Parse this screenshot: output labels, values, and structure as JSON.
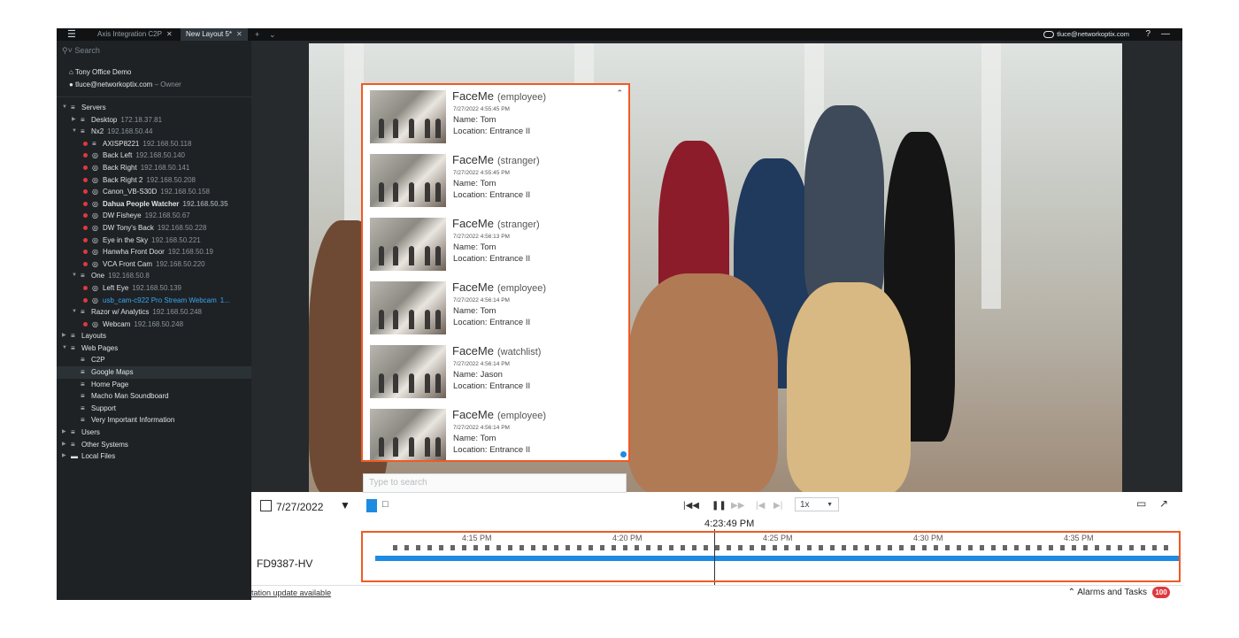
{
  "titlebar": {
    "tabs": [
      {
        "label": "Axis Integration C2P",
        "active": false
      },
      {
        "label": "New Layout 5*",
        "active": true
      }
    ],
    "account": "tluce@networkoptix.com",
    "help": "?",
    "minimize": "—"
  },
  "sidebar": {
    "search_placeholder": "Search",
    "system_name": "Tony Office Demo",
    "user_email": "tluce@networkoptix.com",
    "user_role": "– Owner",
    "tree": [
      {
        "label": "Servers",
        "ip": "",
        "level": 0,
        "icon": "servers-icon",
        "expanded": true
      },
      {
        "label": "Desktop",
        "ip": "172.18.37.81",
        "level": 1,
        "icon": "server-icon",
        "expanded": false
      },
      {
        "label": "Nx2",
        "ip": "192.168.50.44",
        "level": 1,
        "icon": "server-icon",
        "expanded": true
      },
      {
        "label": "AXISP8221",
        "ip": "192.168.50.118",
        "level": 2,
        "icon": "io-module-icon",
        "status": "red"
      },
      {
        "label": "Back Left",
        "ip": "192.168.50.140",
        "level": 2,
        "icon": "camera-icon",
        "status": "red"
      },
      {
        "label": "Back Right",
        "ip": "192.168.50.141",
        "level": 2,
        "icon": "camera-icon",
        "status": "red"
      },
      {
        "label": "Back Right 2",
        "ip": "192.168.50.208",
        "level": 2,
        "icon": "camera-icon",
        "status": "red"
      },
      {
        "label": "Canon_VB-S30D",
        "ip": "192.168.50.158",
        "level": 2,
        "icon": "camera-icon",
        "status": "red"
      },
      {
        "label": "Dahua People Watcher",
        "ip": "192.168.50.35",
        "level": 2,
        "icon": "camera-icon",
        "status": "red",
        "bold": true
      },
      {
        "label": "DW Fisheye",
        "ip": "192.168.50.67",
        "level": 2,
        "icon": "camera-icon",
        "status": "red"
      },
      {
        "label": "DW Tony's Back",
        "ip": "192.168.50.228",
        "level": 2,
        "icon": "camera-icon",
        "status": "red"
      },
      {
        "label": "Eye in the Sky",
        "ip": "192.168.50.221",
        "level": 2,
        "icon": "camera-icon",
        "status": "red"
      },
      {
        "label": "Hanwha Front Door",
        "ip": "192.168.50.19",
        "level": 2,
        "icon": "camera-icon",
        "status": "red"
      },
      {
        "label": "VCA Front Cam",
        "ip": "192.168.50.220",
        "level": 2,
        "icon": "camera-icon",
        "status": "red"
      },
      {
        "label": "One",
        "ip": "192.168.50.8",
        "level": 1,
        "icon": "server-icon",
        "expanded": true
      },
      {
        "label": "Left Eye",
        "ip": "192.168.50.139",
        "level": 2,
        "icon": "camera-icon",
        "status": "red"
      },
      {
        "label": "usb_cam-c922 Pro Stream Webcam",
        "ip": "1...",
        "level": 2,
        "icon": "camera-icon",
        "status": "red",
        "highlight": true
      },
      {
        "label": "Razor w/ Analytics",
        "ip": "192.168.50.248",
        "level": 1,
        "icon": "server-icon",
        "expanded": true
      },
      {
        "label": "Webcam",
        "ip": "192.168.50.248",
        "level": 2,
        "icon": "camera-icon",
        "status": "red"
      },
      {
        "label": "Layouts",
        "ip": "",
        "level": 0,
        "icon": "layouts-icon",
        "expanded": false
      },
      {
        "label": "Web Pages",
        "ip": "",
        "level": 0,
        "icon": "web-pages-icon",
        "expanded": true
      },
      {
        "label": "C2P",
        "ip": "",
        "level": 1,
        "icon": "c2p-icon"
      },
      {
        "label": "Google Maps",
        "ip": "",
        "level": 1,
        "icon": "web-page-icon",
        "selected": true
      },
      {
        "label": "Home Page",
        "ip": "",
        "level": 1,
        "icon": "web-page-icon"
      },
      {
        "label": "Macho Man Soundboard",
        "ip": "",
        "level": 1,
        "icon": "web-page-icon"
      },
      {
        "label": "Support",
        "ip": "",
        "level": 1,
        "icon": "web-page-icon"
      },
      {
        "label": "Very Important Information",
        "ip": "",
        "level": 1,
        "icon": "web-page-icon"
      },
      {
        "label": "Users",
        "ip": "",
        "level": 0,
        "icon": "users-icon",
        "expanded": false
      },
      {
        "label": "Other Systems",
        "ip": "",
        "level": 0,
        "icon": "other-systems-icon",
        "expanded": false
      },
      {
        "label": "Local Files",
        "ip": "",
        "level": 0,
        "icon": "folder-icon",
        "expanded": false
      }
    ]
  },
  "panel": {
    "results": [
      {
        "title": "FaceMe",
        "type": "(employee)",
        "time": "7/27/2022 4:55:45 PM",
        "name": "Name: Tom",
        "location": "Location: Entrance II"
      },
      {
        "title": "FaceMe",
        "type": "(stranger)",
        "time": "7/27/2022 4:55:45 PM",
        "name": "Name: Tom",
        "location": "Location: Entrance II"
      },
      {
        "title": "FaceMe",
        "type": "(stranger)",
        "time": "7/27/2022 4:56:13 PM",
        "name": "Name: Tom",
        "location": "Location: Entrance II"
      },
      {
        "title": "FaceMe",
        "type": "(employee)",
        "time": "7/27/2022 4:56:14 PM",
        "name": "Name: Tom",
        "location": "Location: Entrance II"
      },
      {
        "title": "FaceMe",
        "type": "(watchlist)",
        "time": "7/27/2022 4:56:14 PM",
        "name": "Name: Jason",
        "location": "Location: Entrance II"
      },
      {
        "title": "FaceMe",
        "type": "(employee)",
        "time": "7/27/2022 4:56:14 PM",
        "name": "Name: Tom",
        "location": "Location: Entrance II"
      }
    ],
    "search_placeholder": "Type to search"
  },
  "timeline": {
    "date": "7/27/2022",
    "speed": "1x",
    "current_time": "4:23:49 PM",
    "camera": "FD9387-HV",
    "labels": [
      "4:15 PM",
      "4:20 PM",
      "4:25 PM",
      "4:30 PM",
      "4:35 PM"
    ]
  },
  "status": {
    "update_text": "tation update available",
    "alarms_label": "Alarms and Tasks",
    "alarm_count": "100"
  },
  "colors": {
    "accent": "#1e8be3",
    "highlight_box": "#f05a23",
    "alert": "#e0383e"
  }
}
